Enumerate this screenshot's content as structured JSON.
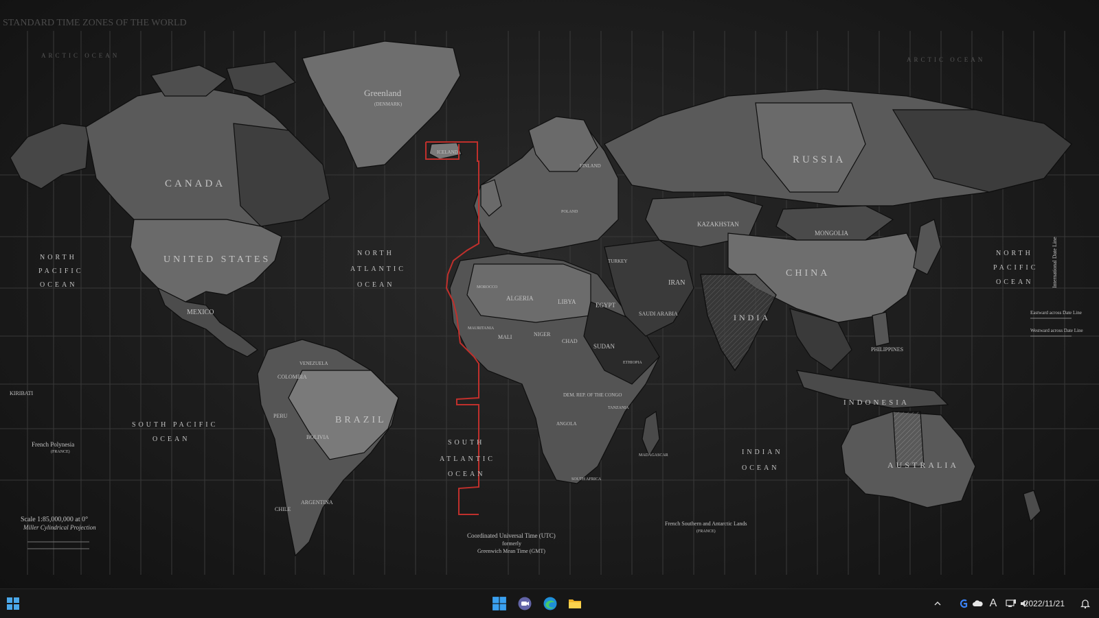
{
  "map": {
    "title": "STANDARD TIME ZONES OF THE WORLD",
    "countries": {
      "canada": "CANADA",
      "united_states": "UNITED STATES",
      "mexico": "MEXICO",
      "brazil": "BRAZIL",
      "russia": "RUSSIA",
      "china": "CHINA",
      "australia": "AUSTRALIA",
      "indonesia": "INDONESIA",
      "india": "INDIA",
      "algeria": "ALGERIA",
      "egypt": "EGYPT",
      "libya": "LIBYA",
      "sudan": "SUDAN",
      "saudi_arabia": "SAUDI ARABIA",
      "iran": "IRAN",
      "kazakhstan": "KAZAKHSTAN",
      "mongolia": "MONGOLIA",
      "argentina": "ARGENTINA",
      "peru": "PERU",
      "bolivia": "BOLIVIA",
      "colombia": "COLOMBIA",
      "venezuela": "VENEZUELA",
      "chile": "CHILE",
      "niger": "NIGER",
      "chad": "CHAD",
      "mali": "MALI",
      "angola": "ANGOLA",
      "turkey": "TURKEY",
      "finland": "FINLAND",
      "poland": "POLAND",
      "philippines": "PHILIPPINES",
      "greenland": "Greenland",
      "greenland_sub": "(DENMARK)",
      "iceland": "ICELAND",
      "kiribati": "KIRIBATI",
      "french_polynesia": "French Polynesia",
      "french_polynesia_sub": "(FRANCE)",
      "madagascar": "MADAGASCAR",
      "tanzania": "TANZANIA",
      "ethiopia": "ETHIOPIA",
      "south_africa": "SOUTH AFRICA",
      "dem_rep_congo": "DEM. REP. OF THE CONGO",
      "mauritania": "MAURITANIA",
      "morocco": "MOROCCO"
    },
    "oceans": {
      "north_pacific": [
        "NORTH",
        "PACIFIC",
        "OCEAN"
      ],
      "north_pacific_east": [
        "NORTH",
        "PACIFIC",
        "OCEAN"
      ],
      "north_atlantic": [
        "NORTH",
        "ATLANTIC",
        "OCEAN"
      ],
      "south_pacific": [
        "SOUTH PACIFIC",
        "OCEAN"
      ],
      "south_atlantic": [
        "SOUTH",
        "ATLANTIC",
        "OCEAN"
      ],
      "indian": [
        "INDIAN",
        "OCEAN"
      ],
      "arctic": "ARCTIC OCEAN",
      "arctic_east": "ARCTIC OCEAN"
    },
    "scale": {
      "line1": "Scale 1:85,000,000 at 0°",
      "line2": "Miller Cylindrical Projection"
    },
    "utc_note": {
      "line1": "Coordinated Universal Time (UTC)",
      "line2": "formerly",
      "line3": "Greenwich Mean Time (GMT)"
    },
    "date_line": {
      "label": "International Date Line",
      "eastward": "Eastward across Date Line",
      "westward": "Westward across Date Line"
    },
    "french_southern": [
      "French Southern and Antarctic Lands",
      "(FRANCE)"
    ],
    "accent_color": "#c0302c"
  },
  "taskbar": {
    "clock_date": "2022/11/21",
    "ime_label": "A",
    "icons": [
      "windows-start-icon",
      "windows-logo-icon",
      "teams-chat-icon",
      "edge-browser-icon",
      "file-explorer-icon"
    ],
    "tray_icons": [
      "chevron-up-icon",
      "g-app-icon",
      "onedrive-cloud-icon",
      "ime-icon",
      "network-icon",
      "volume-icon",
      "notification-bell-icon"
    ]
  }
}
